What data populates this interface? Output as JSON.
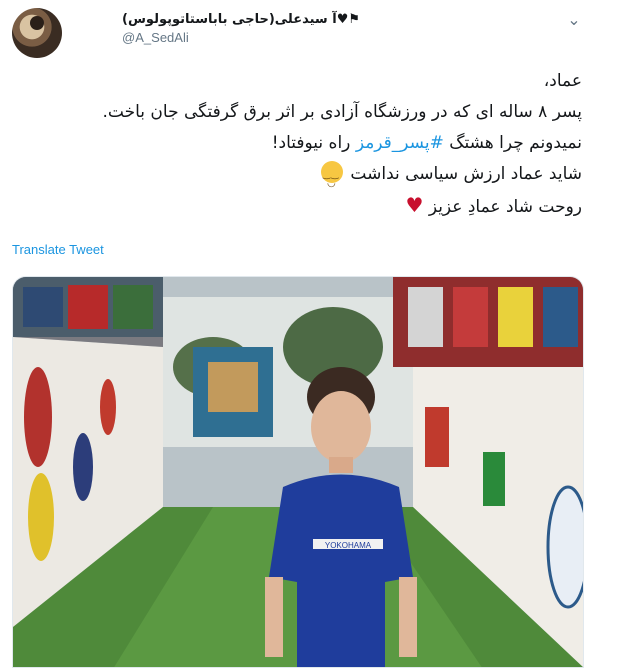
{
  "tweet": {
    "display_name": "آ سیدعلی(حاجی باباستاتوپولوس)",
    "name_icons": [
      "black-heart-icon",
      "black-flag-icon"
    ],
    "handle": "@A_SedAli",
    "lines": [
      "عماد،",
      "پسر ۸ ساله ای که در ورزشگاه آزادی بر اثر برق گرفتگی جان باخت.",
      {
        "before": "نمیدونم چرا هشتگ ",
        "hashtag": "#پسر_قرمز",
        "after": " راه نیوفتاد!"
      },
      {
        "text": "شاید عماد ارزش سیاسی نداشت",
        "emoji": "relieved-face-emoji"
      },
      {
        "text": "روحت شاد عمادِ عزیز",
        "emoji": "red-heart-emoji"
      }
    ],
    "translate_label": "Translate Tweet",
    "media": {
      "description_icon": "photo",
      "jersey_sponsor": "YOKOHAMA"
    }
  },
  "colors": {
    "link": "#1b95e0",
    "secondary_text": "#657786",
    "heart": "#c8102e"
  }
}
